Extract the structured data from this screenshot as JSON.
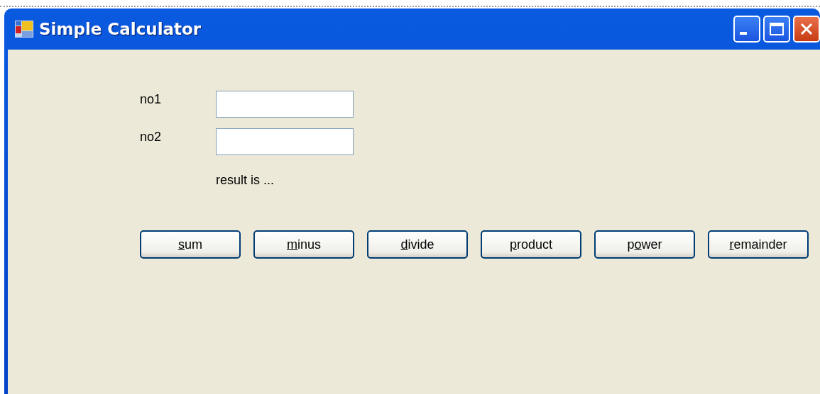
{
  "window": {
    "title": "Simple Calculator"
  },
  "fields": [
    {
      "label": "no1"
    },
    {
      "label": "no2"
    }
  ],
  "result": "result is ...",
  "buttons": [
    {
      "access_key": "s",
      "rest": "um"
    },
    {
      "access_key": "m",
      "rest": "inus"
    },
    {
      "access_key": "d",
      "rest": "ivide"
    },
    {
      "access_key": "p",
      "rest": "roduct"
    },
    {
      "lead": "p",
      "access_key": "o",
      "rest": "wer"
    },
    {
      "access_key": "r",
      "rest": "emainder"
    }
  ]
}
